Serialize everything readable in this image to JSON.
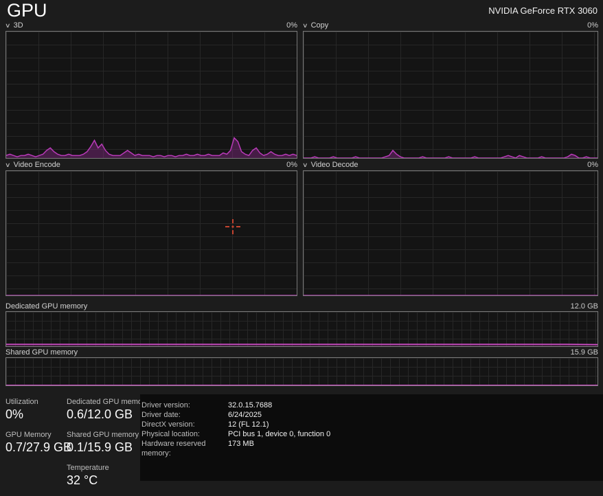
{
  "header": {
    "page_title": "GPU",
    "gpu_name": "NVIDIA GeForce RTX 3060"
  },
  "charts": [
    {
      "label": "3D",
      "value": "0%"
    },
    {
      "label": "Copy",
      "value": "0%"
    },
    {
      "label": "Video Encode",
      "value": "0%"
    },
    {
      "label": "Video Decode",
      "value": "0%"
    }
  ],
  "memory": [
    {
      "label": "Dedicated GPU memory",
      "value": "12.0 GB"
    },
    {
      "label": "Shared GPU memory",
      "value": "15.9 GB"
    }
  ],
  "stats_left": [
    {
      "label": "Utilization",
      "value": "0%"
    },
    {
      "label": "GPU Memory",
      "value": "0.7/27.9 GB"
    }
  ],
  "stats_mid": [
    {
      "label": "Dedicated GPU memory",
      "value": "0.6/12.0 GB"
    },
    {
      "label": "Shared GPU memory",
      "value": "0.1/15.9 GB"
    },
    {
      "label": "Temperature",
      "value": "32 °C"
    }
  ],
  "details": [
    {
      "label": "Driver version:",
      "value": "32.0.15.7688"
    },
    {
      "label": "Driver date:",
      "value": "6/24/2025"
    },
    {
      "label": "DirectX version:",
      "value": "12 (FL 12.1)"
    },
    {
      "label": "Physical location:",
      "value": "PCI bus 1, device 0, function 0"
    },
    {
      "label": "Hardware reserved memory:",
      "value": "173 MB"
    }
  ],
  "colors": {
    "accent_stroke": "#b83ab8",
    "accent_fill": "rgba(130,40,130,0.45)",
    "memory_stroke": "#d94fd0",
    "memory_fill": "rgba(150,55,140,0.35)"
  },
  "chart_data": [
    {
      "type": "area",
      "name": "3D utilization history",
      "unit": "%",
      "ylim": [
        0,
        100
      ],
      "grid": true,
      "stroke": "#b83ab8",
      "fill": "rgba(130,40,130,0.45)",
      "values": [
        2,
        3,
        2,
        1,
        2,
        2,
        3,
        2,
        1,
        2,
        3,
        6,
        8,
        5,
        3,
        2,
        2,
        3,
        2,
        2,
        2,
        3,
        5,
        9,
        14,
        8,
        11,
        6,
        3,
        2,
        2,
        2,
        4,
        6,
        4,
        2,
        3,
        2,
        2,
        2,
        1,
        2,
        2,
        1,
        2,
        2,
        1,
        2,
        2,
        3,
        2,
        2,
        3,
        2,
        2,
        3,
        2,
        2,
        2,
        4,
        3,
        6,
        16,
        13,
        5,
        3,
        2,
        6,
        8,
        4,
        2,
        3,
        5,
        3,
        2,
        2,
        3,
        2,
        3,
        2
      ]
    },
    {
      "type": "area",
      "name": "Copy utilization history",
      "unit": "%",
      "ylim": [
        0,
        100
      ],
      "grid": true,
      "stroke": "#b83ab8",
      "fill": "rgba(130,40,130,0.45)",
      "values": [
        0,
        0,
        0,
        1,
        0,
        0,
        0,
        0,
        1,
        0,
        0,
        0,
        0,
        0,
        1,
        0,
        0,
        0,
        0,
        0,
        0,
        0,
        1,
        2,
        6,
        3,
        1,
        0,
        0,
        0,
        0,
        0,
        1,
        0,
        0,
        0,
        0,
        0,
        0,
        1,
        0,
        0,
        0,
        0,
        0,
        0,
        1,
        0,
        0,
        0,
        0,
        0,
        0,
        0,
        1,
        2,
        1,
        0,
        2,
        1,
        0,
        0,
        0,
        0,
        1,
        0,
        0,
        0,
        0,
        0,
        0,
        1,
        3,
        2,
        0,
        0,
        1,
        0,
        0,
        0
      ]
    },
    {
      "type": "area",
      "name": "Video Encode utilization history",
      "unit": "%",
      "ylim": [
        0,
        100
      ],
      "grid": true,
      "stroke": "#b83ab8",
      "fill": "rgba(130,40,130,0.45)",
      "values": [
        0,
        0,
        0,
        0,
        0,
        0,
        0,
        0,
        0,
        0,
        0,
        0,
        0,
        0,
        0,
        0,
        0,
        0,
        0,
        0
      ]
    },
    {
      "type": "area",
      "name": "Video Decode utilization history",
      "unit": "%",
      "ylim": [
        0,
        100
      ],
      "grid": true,
      "stroke": "#b83ab8",
      "fill": "rgba(130,40,130,0.45)",
      "values": [
        0,
        0,
        0,
        0,
        0,
        0,
        0,
        0,
        0,
        0,
        0,
        0,
        0,
        0,
        0,
        0,
        0,
        0,
        0,
        0
      ]
    },
    {
      "type": "area",
      "name": "Dedicated GPU memory usage history",
      "unit": "GB",
      "ylim": [
        0,
        12
      ],
      "grid": true,
      "stroke": "#d94fd0",
      "fill": "rgba(150,55,140,0.35)",
      "values": [
        0.7,
        0.7,
        0.7,
        0.7,
        0.7,
        0.7,
        0.7,
        0.7,
        0.7,
        0.7,
        0.7,
        0.7,
        0.7,
        0.7,
        0.7,
        0.7,
        0.7,
        0.7,
        0.7,
        0.6
      ]
    },
    {
      "type": "area",
      "name": "Shared GPU memory usage history",
      "unit": "GB",
      "ylim": [
        0,
        15.9
      ],
      "grid": true,
      "stroke": "#d94fd0",
      "fill": "rgba(150,55,140,0.35)",
      "values": [
        0.1,
        0.1,
        0.1,
        0.1,
        0.1,
        0.1,
        0.1,
        0.1,
        0.1,
        0.1,
        0.1,
        0.1,
        0.1,
        0.1,
        0.1,
        0.1,
        0.1,
        0.1,
        0.1,
        0.1
      ]
    }
  ]
}
